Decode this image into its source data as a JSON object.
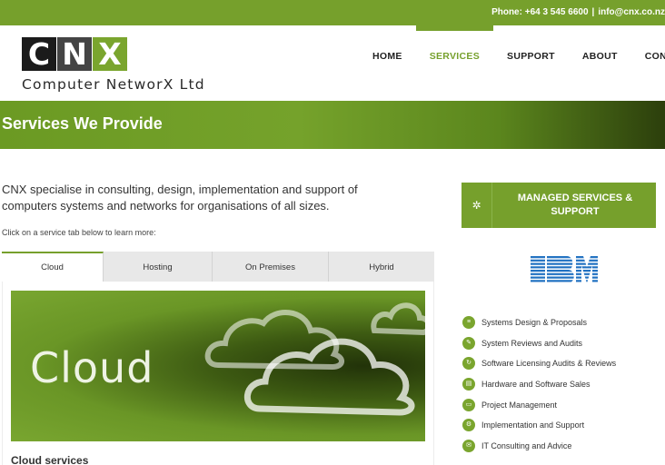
{
  "topbar": {
    "phone": "Phone: +64 3 545 6600",
    "separator": "|",
    "email": "info@cnx.co.nz"
  },
  "logo": {
    "letters": [
      "C",
      "N",
      "X"
    ],
    "company_name": "Computer NetworX  Ltd"
  },
  "nav": {
    "items": [
      "HOME",
      "SERVICES",
      "SUPPORT",
      "ABOUT",
      "CONTACT"
    ],
    "active": "SERVICES"
  },
  "banner": {
    "title": "Services We Provide"
  },
  "main": {
    "intro": "CNX specialise in consulting, design, implementation and support of computers systems and networks for organisations of all sizes.",
    "hint": "Click on a service tab below to learn more:",
    "tabs": [
      "Cloud",
      "Hosting",
      "On Premises",
      "Hybrid"
    ],
    "active_tab": "Cloud",
    "hero_word": "Cloud",
    "section_title": "Cloud services"
  },
  "sidebar": {
    "managed_button": "MANAGED SERVICES & SUPPORT",
    "managed_icon": "gear-icon",
    "partner_logo": "IBM",
    "services": [
      "Systems Design & Proposals",
      "System Reviews and Audits",
      "Software Licensing Audits & Reviews",
      "Hardware and Software Sales",
      "Project Management",
      "Implementation and Support",
      "IT Consulting and Advice"
    ]
  },
  "colors": {
    "brand_green": "#76a02c",
    "dark": "#1b1b1b",
    "white": "#ffffff"
  }
}
